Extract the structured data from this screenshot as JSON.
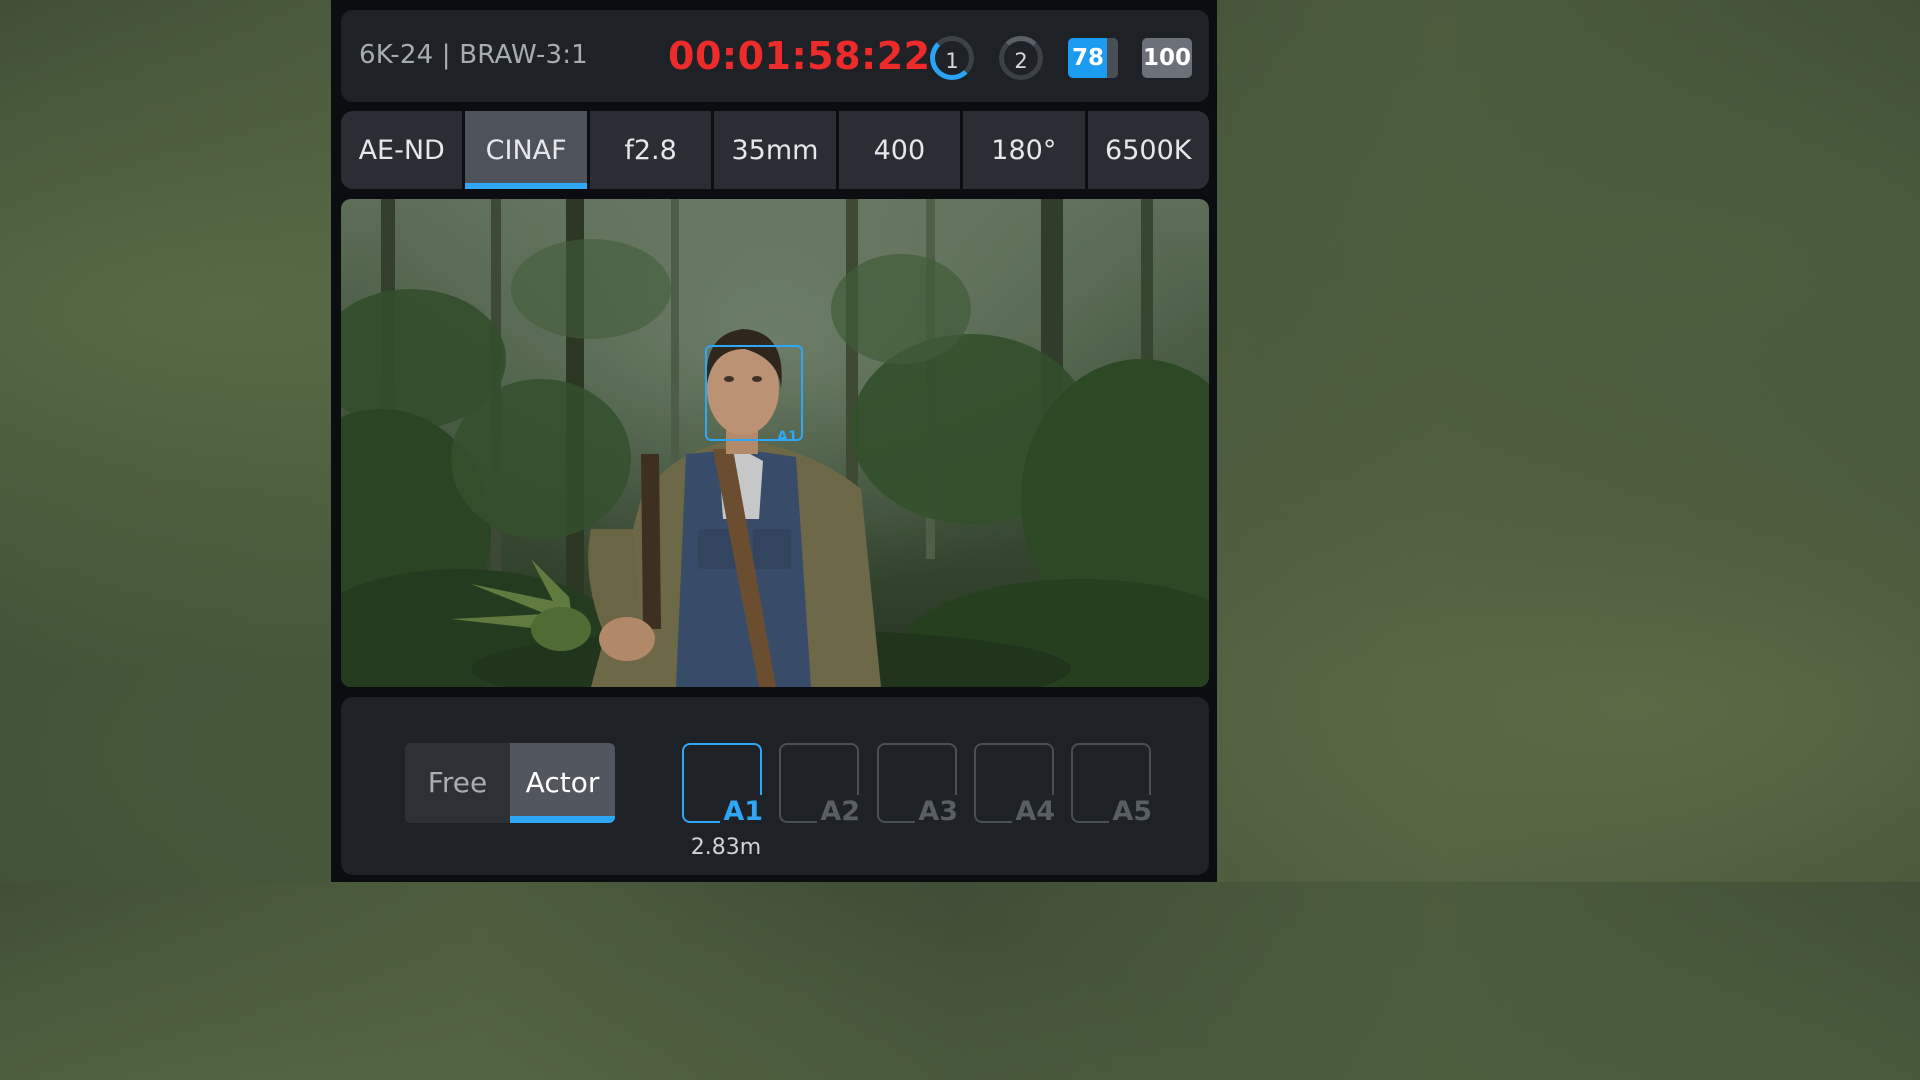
{
  "status_bar": {
    "format": "6K-24 | BRAW-3:1",
    "timecode": "00:01:58:22",
    "timecode_color": "#ee2b2b",
    "card1_label": "1",
    "card2_label": "2",
    "battery1_level": "78",
    "battery2_level": "100"
  },
  "params": [
    {
      "label": "AE-ND",
      "active": false
    },
    {
      "label": "CINAF",
      "active": true
    },
    {
      "label": "f2.8",
      "active": false
    },
    {
      "label": "35mm",
      "active": false
    },
    {
      "label": "400",
      "active": false
    },
    {
      "label": "180°",
      "active": false
    },
    {
      "label": "6500K",
      "active": false
    }
  ],
  "viewfinder": {
    "focus_box_label": "A1",
    "accent_color": "#2fa6f6"
  },
  "tracking": {
    "modes": [
      {
        "label": "Free",
        "active": false
      },
      {
        "label": "Actor",
        "active": true
      }
    ],
    "slots": [
      {
        "label": "A1",
        "active": true
      },
      {
        "label": "A2",
        "active": false
      },
      {
        "label": "A3",
        "active": false
      },
      {
        "label": "A4",
        "active": false
      },
      {
        "label": "A5",
        "active": false
      }
    ],
    "distance": "2.83m"
  }
}
